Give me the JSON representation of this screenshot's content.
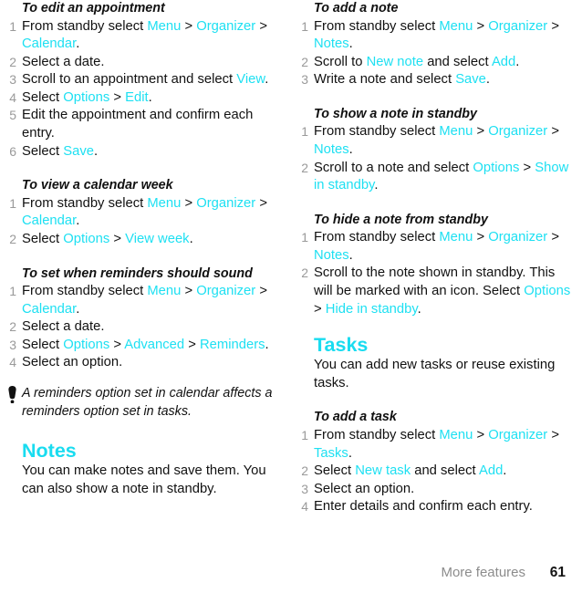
{
  "colors": {
    "ui_accent": "#1ee0f2",
    "heading_accent": "#19dcf0",
    "body_text": "#111111",
    "step_number": "#9a9a9a",
    "footer_text": "#8c8c8c"
  },
  "left_column": {
    "proc_edit_appointment": {
      "title": "To edit an appointment",
      "steps": [
        {
          "num": "1",
          "parts": [
            {
              "t": "From standby select ",
              "ui": false
            },
            {
              "t": "Menu",
              "ui": true
            },
            {
              "t": " > ",
              "ui": false
            },
            {
              "t": "Organizer",
              "ui": true
            },
            {
              "t": " > ",
              "ui": false
            },
            {
              "t": "Calendar",
              "ui": true
            },
            {
              "t": ".",
              "ui": false
            }
          ]
        },
        {
          "num": "2",
          "parts": [
            {
              "t": "Select a date.",
              "ui": false
            }
          ]
        },
        {
          "num": "3",
          "parts": [
            {
              "t": "Scroll to an appointment and select ",
              "ui": false
            },
            {
              "t": "View",
              "ui": true
            },
            {
              "t": ".",
              "ui": false
            }
          ]
        },
        {
          "num": "4",
          "parts": [
            {
              "t": "Select ",
              "ui": false
            },
            {
              "t": "Options",
              "ui": true
            },
            {
              "t": " > ",
              "ui": false
            },
            {
              "t": "Edit",
              "ui": true
            },
            {
              "t": ".",
              "ui": false
            }
          ]
        },
        {
          "num": "5",
          "parts": [
            {
              "t": "Edit the appointment and confirm each entry.",
              "ui": false
            }
          ]
        },
        {
          "num": "6",
          "parts": [
            {
              "t": "Select ",
              "ui": false
            },
            {
              "t": "Save",
              "ui": true
            },
            {
              "t": ".",
              "ui": false
            }
          ]
        }
      ]
    },
    "proc_view_calendar_week": {
      "title": "To view a calendar week",
      "steps": [
        {
          "num": "1",
          "parts": [
            {
              "t": "From standby select ",
              "ui": false
            },
            {
              "t": "Menu",
              "ui": true
            },
            {
              "t": " > ",
              "ui": false
            },
            {
              "t": "Organizer",
              "ui": true
            },
            {
              "t": " > ",
              "ui": false
            },
            {
              "t": "Calendar",
              "ui": true
            },
            {
              "t": ".",
              "ui": false
            }
          ]
        },
        {
          "num": "2",
          "parts": [
            {
              "t": "Select ",
              "ui": false
            },
            {
              "t": "Options",
              "ui": true
            },
            {
              "t": " > ",
              "ui": false
            },
            {
              "t": "View week",
              "ui": true
            },
            {
              "t": ".",
              "ui": false
            }
          ]
        }
      ]
    },
    "proc_set_reminders": {
      "title": "To set when reminders should sound",
      "steps": [
        {
          "num": "1",
          "parts": [
            {
              "t": "From standby select ",
              "ui": false
            },
            {
              "t": "Menu",
              "ui": true
            },
            {
              "t": " > ",
              "ui": false
            },
            {
              "t": "Organizer",
              "ui": true
            },
            {
              "t": " > ",
              "ui": false
            },
            {
              "t": "Calendar",
              "ui": true
            },
            {
              "t": ".",
              "ui": false
            }
          ]
        },
        {
          "num": "2",
          "parts": [
            {
              "t": "Select a date.",
              "ui": false
            }
          ]
        },
        {
          "num": "3",
          "parts": [
            {
              "t": "Select ",
              "ui": false
            },
            {
              "t": "Options",
              "ui": true
            },
            {
              "t": " > ",
              "ui": false
            },
            {
              "t": "Advanced",
              "ui": true
            },
            {
              "t": " > ",
              "ui": false
            },
            {
              "t": "Reminders",
              "ui": true
            },
            {
              "t": ".",
              "ui": false
            }
          ]
        },
        {
          "num": "4",
          "parts": [
            {
              "t": "Select an option.",
              "ui": false
            }
          ]
        }
      ]
    },
    "tip": {
      "icon": "exclamation-tip-icon",
      "text": "A reminders option set in calendar affects a reminders option set in tasks."
    },
    "section_notes": {
      "heading": "Notes",
      "body": "You can make notes and save them. You can also show a note in standby."
    }
  },
  "right_column": {
    "proc_add_note": {
      "title": "To add a note",
      "steps": [
        {
          "num": "1",
          "parts": [
            {
              "t": "From standby select ",
              "ui": false
            },
            {
              "t": "Menu",
              "ui": true
            },
            {
              "t": " > ",
              "ui": false
            },
            {
              "t": "Organizer",
              "ui": true
            },
            {
              "t": " > ",
              "ui": false
            },
            {
              "t": "Notes",
              "ui": true
            },
            {
              "t": ".",
              "ui": false
            }
          ]
        },
        {
          "num": "2",
          "parts": [
            {
              "t": "Scroll to ",
              "ui": false
            },
            {
              "t": "New note",
              "ui": true
            },
            {
              "t": " and select ",
              "ui": false
            },
            {
              "t": "Add",
              "ui": true
            },
            {
              "t": ".",
              "ui": false
            }
          ]
        },
        {
          "num": "3",
          "parts": [
            {
              "t": "Write a note and select ",
              "ui": false
            },
            {
              "t": "Save",
              "ui": true
            },
            {
              "t": ".",
              "ui": false
            }
          ]
        }
      ]
    },
    "proc_show_note_standby": {
      "title": "To show a note in standby",
      "steps": [
        {
          "num": "1",
          "parts": [
            {
              "t": "From standby select ",
              "ui": false
            },
            {
              "t": "Menu",
              "ui": true
            },
            {
              "t": " > ",
              "ui": false
            },
            {
              "t": "Organizer",
              "ui": true
            },
            {
              "t": " > ",
              "ui": false
            },
            {
              "t": "Notes",
              "ui": true
            },
            {
              "t": ".",
              "ui": false
            }
          ]
        },
        {
          "num": "2",
          "parts": [
            {
              "t": "Scroll to a note and select ",
              "ui": false
            },
            {
              "t": "Options",
              "ui": true
            },
            {
              "t": " > ",
              "ui": false
            },
            {
              "t": "Show in standby",
              "ui": true
            },
            {
              "t": ".",
              "ui": false
            }
          ]
        }
      ]
    },
    "proc_hide_note_standby": {
      "title": "To hide a note from standby",
      "steps": [
        {
          "num": "1",
          "parts": [
            {
              "t": "From standby select ",
              "ui": false
            },
            {
              "t": "Menu",
              "ui": true
            },
            {
              "t": " > ",
              "ui": false
            },
            {
              "t": "Organizer",
              "ui": true
            },
            {
              "t": " > ",
              "ui": false
            },
            {
              "t": "Notes",
              "ui": true
            },
            {
              "t": ".",
              "ui": false
            }
          ]
        },
        {
          "num": "2",
          "parts": [
            {
              "t": "Scroll to the note shown in standby. This will be marked with an icon. Select ",
              "ui": false
            },
            {
              "t": "Options",
              "ui": true
            },
            {
              "t": " > ",
              "ui": false
            },
            {
              "t": "Hide in standby",
              "ui": true
            },
            {
              "t": ".",
              "ui": false
            }
          ]
        }
      ]
    },
    "section_tasks": {
      "heading": "Tasks",
      "body": "You can add new tasks or reuse existing tasks."
    },
    "proc_add_task": {
      "title": "To add a task",
      "steps": [
        {
          "num": "1",
          "parts": [
            {
              "t": "From standby select ",
              "ui": false
            },
            {
              "t": "Menu",
              "ui": true
            },
            {
              "t": " > ",
              "ui": false
            },
            {
              "t": "Organizer",
              "ui": true
            },
            {
              "t": " > ",
              "ui": false
            },
            {
              "t": "Tasks",
              "ui": true
            },
            {
              "t": ".",
              "ui": false
            }
          ]
        },
        {
          "num": "2",
          "parts": [
            {
              "t": "Select ",
              "ui": false
            },
            {
              "t": "New task",
              "ui": true
            },
            {
              "t": " and select ",
              "ui": false
            },
            {
              "t": "Add",
              "ui": true
            },
            {
              "t": ".",
              "ui": false
            }
          ]
        },
        {
          "num": "3",
          "parts": [
            {
              "t": "Select an option.",
              "ui": false
            }
          ]
        },
        {
          "num": "4",
          "parts": [
            {
              "t": "Enter details and confirm each entry.",
              "ui": false
            }
          ]
        }
      ]
    }
  },
  "footer": {
    "section": "More features",
    "page_number": "61"
  }
}
